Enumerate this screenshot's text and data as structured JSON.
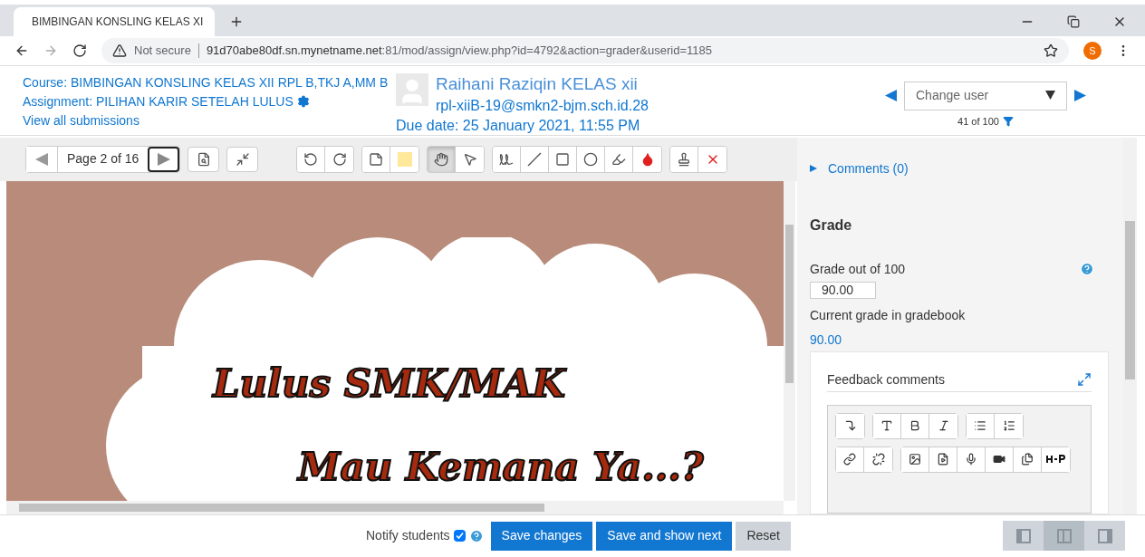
{
  "browser": {
    "tab_title": "BIMBINGAN KONSLING KELAS XI",
    "security": "Not secure",
    "url_host": "91d70abe80df.sn.mynetname.net",
    "url_rest": ":81/mod/assign/view.php?id=4792&action=grader&userid=1185",
    "profile": "S"
  },
  "header": {
    "course": "Course: BIMBINGAN KONSLING KELAS XII RPL B,TKJ A,MM B",
    "assignment": "Assignment: PILIHAN KARIR SETELAH LULUS",
    "view_all": "View all submissions",
    "user_name": "Raihani Raziqin KELAS xii",
    "user_email": "rpl-xiiB-19@smkn2-bjm.sch.id.28",
    "due_date": "Due date: 25 January 2021, 11:55 PM",
    "change_user": "Change user",
    "count": "41 of 100"
  },
  "toolbar": {
    "page": "Page 2 of 16",
    "tools": [
      {
        "kind": "rotate-left",
        "selected": false
      },
      {
        "kind": "rotate-right",
        "selected": false
      },
      {
        "kind": "comment",
        "selected": false
      },
      {
        "kind": "comment-color",
        "selected": false
      },
      {
        "kind": "hand",
        "selected": true
      },
      {
        "kind": "pointer",
        "selected": false
      },
      {
        "kind": "pen",
        "selected": false
      },
      {
        "kind": "line",
        "selected": false
      },
      {
        "kind": "rectangle",
        "selected": false
      },
      {
        "kind": "oval",
        "selected": false
      },
      {
        "kind": "highlight",
        "selected": false
      },
      {
        "kind": "ink-color",
        "selected": false
      },
      {
        "kind": "stamp",
        "selected": false
      },
      {
        "kind": "delete",
        "selected": false
      }
    ]
  },
  "document": {
    "lines": [
      "Lulus SMK/MAK",
      "Mau Kemana Ya...?"
    ]
  },
  "panel": {
    "comments": "Comments (0)",
    "grade_heading": "Grade",
    "grade_label": "Grade out of 100",
    "grade_value": "90.00",
    "current_label": "Current grade in gradebook",
    "current_value": "90.00",
    "feedback_label": "Feedback comments"
  },
  "footer": {
    "notify_label": "Notify students",
    "notify_checked": true,
    "buttons": [
      {
        "label": "Save changes",
        "kind": "primary"
      },
      {
        "label": "Save and show next",
        "kind": "primary"
      },
      {
        "label": "Reset",
        "kind": "secondary"
      }
    ],
    "layouts": [
      {
        "kind": "collapse-grader",
        "selected": false
      },
      {
        "kind": "default",
        "selected": true
      },
      {
        "kind": "collapse-review",
        "selected": false
      }
    ]
  }
}
